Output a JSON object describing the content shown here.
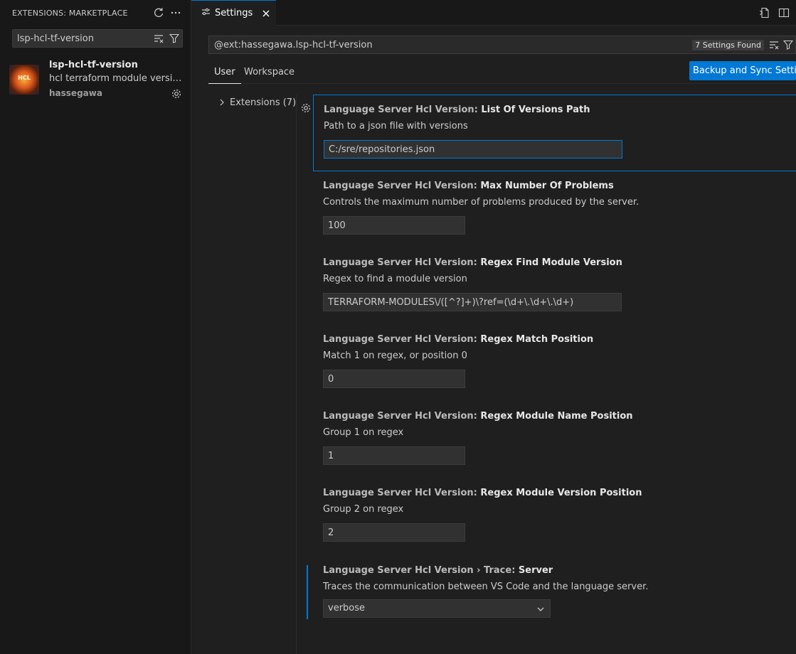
{
  "sidebar": {
    "title": "EXTENSIONS: MARKETPLACE",
    "search_value": "lsp-hcl-tf-version",
    "extension": {
      "name": "lsp-hcl-tf-version",
      "description": "hcl terraform module version v...",
      "publisher": "hassegawa",
      "logo_text": "HCL"
    }
  },
  "tab": {
    "label": "Settings"
  },
  "settings": {
    "query": "@ext:hassegawa.lsp-hcl-tf-version",
    "found": "7 Settings Found",
    "scope_user": "User",
    "scope_workspace": "Workspace",
    "sync_button": "Backup and Sync Settings",
    "toc_item": "Extensions (7)",
    "items": [
      {
        "category": "Language Server Hcl Version: ",
        "name": "List Of Versions Path",
        "description": "Path to a json file with versions",
        "value": "C:/sre/repositories.json"
      },
      {
        "category": "Language Server Hcl Version: ",
        "name": "Max Number Of Problems",
        "description": "Controls the maximum number of problems produced by the server.",
        "value": "100"
      },
      {
        "category": "Language Server Hcl Version: ",
        "name": "Regex Find Module Version",
        "description": "Regex to find a module version",
        "value": "TERRAFORM-MODULES\\/([^?]+)\\?ref=(\\d+\\.\\d+\\.\\d+)"
      },
      {
        "category": "Language Server Hcl Version: ",
        "name": "Regex Match Position",
        "description": "Match 1 on regex, or position 0",
        "value": "0"
      },
      {
        "category": "Language Server Hcl Version: ",
        "name": "Regex Module Name Position",
        "description": "Group 1 on regex",
        "value": "1"
      },
      {
        "category": "Language Server Hcl Version: ",
        "name": "Regex Module Version Position",
        "description": "Group 2 on regex",
        "value": "2"
      },
      {
        "category": "Language Server Hcl Version › Trace: ",
        "name": "Server",
        "description": "Traces the communication between VS Code and the language server.",
        "value": "verbose"
      }
    ]
  },
  "colors": {
    "accent": "#0078d4",
    "background": "#1f1f1f",
    "sidebar": "#181818"
  }
}
